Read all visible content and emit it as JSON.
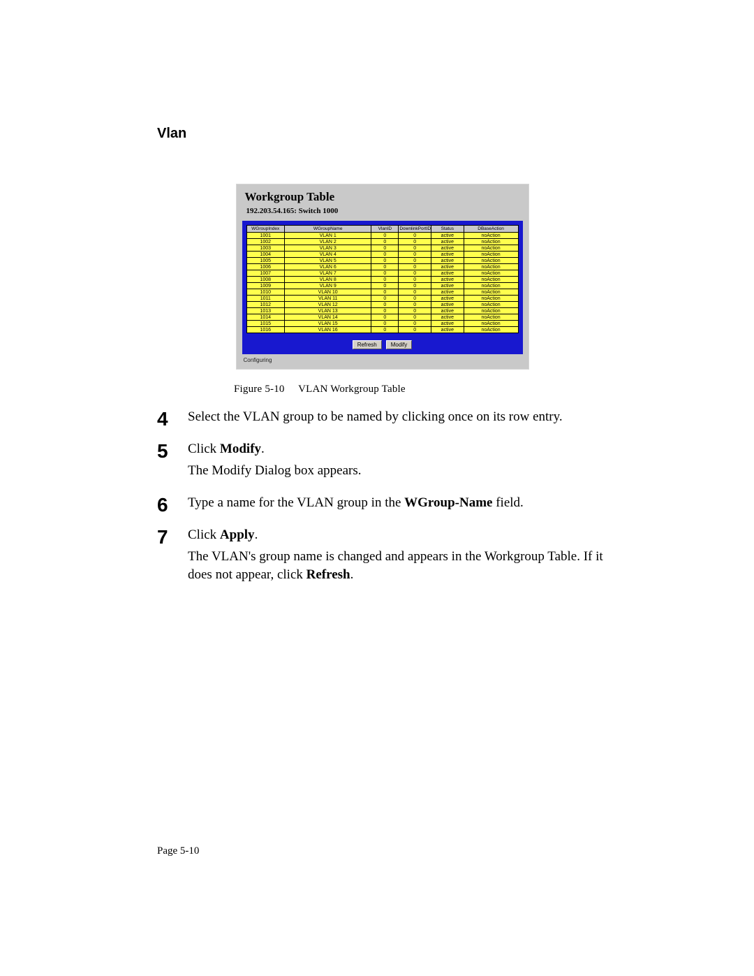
{
  "section_heading": "Vlan",
  "screenshot": {
    "title": "Workgroup Table",
    "subtitle": "192.203.54.165: Switch 1000",
    "headers": [
      "WGroupIndex",
      "WGroupName",
      "VlanID",
      "DownlinkPortID",
      "Status",
      "DBaseAction"
    ],
    "rows": [
      [
        "1001",
        "VLAN 1",
        "0",
        "0",
        "active",
        "noAction"
      ],
      [
        "1002",
        "VLAN 2",
        "0",
        "0",
        "active",
        "noAction"
      ],
      [
        "1003",
        "VLAN 3",
        "0",
        "0",
        "active",
        "noAction"
      ],
      [
        "1004",
        "VLAN 4",
        "0",
        "0",
        "active",
        "noAction"
      ],
      [
        "1005",
        "VLAN 5",
        "0",
        "0",
        "active",
        "noAction"
      ],
      [
        "1006",
        "VLAN 6",
        "0",
        "0",
        "active",
        "noAction"
      ],
      [
        "1007",
        "VLAN 7",
        "0",
        "0",
        "active",
        "noAction"
      ],
      [
        "1008",
        "VLAN 8",
        "0",
        "0",
        "active",
        "noAction"
      ],
      [
        "1009",
        "VLAN 9",
        "0",
        "0",
        "active",
        "noAction"
      ],
      [
        "1010",
        "VLAN 10",
        "0",
        "0",
        "active",
        "noAction"
      ],
      [
        "1011",
        "VLAN 11",
        "0",
        "0",
        "active",
        "noAction"
      ],
      [
        "1012",
        "VLAN 12",
        "0",
        "0",
        "active",
        "noAction"
      ],
      [
        "1013",
        "VLAN 13",
        "0",
        "0",
        "active",
        "noAction"
      ],
      [
        "1014",
        "VLAN 14",
        "0",
        "0",
        "active",
        "noAction"
      ],
      [
        "1015",
        "VLAN 15",
        "0",
        "0",
        "active",
        "noAction"
      ],
      [
        "1016",
        "VLAN 16",
        "0",
        "0",
        "active",
        "noAction"
      ]
    ],
    "buttons": {
      "refresh": "Refresh",
      "modify": "Modify"
    },
    "status": "Configuring"
  },
  "caption_label": "Figure 5-10",
  "caption_text": "VLAN Workgroup Table",
  "steps": [
    {
      "num": "4",
      "lines": [
        [
          {
            "t": "Select the VLAN group to be named by clicking once on its row entry."
          }
        ]
      ]
    },
    {
      "num": "5",
      "lines": [
        [
          {
            "t": "Click "
          },
          {
            "t": "Modify",
            "b": true
          },
          {
            "t": "."
          }
        ],
        [
          {
            "t": "The Modify Dialog box appears."
          }
        ]
      ]
    },
    {
      "num": "6",
      "lines": [
        [
          {
            "t": "Type a name for the VLAN group in the "
          },
          {
            "t": "WGroup-Name",
            "b": true
          },
          {
            "t": " field."
          }
        ]
      ]
    },
    {
      "num": "7",
      "lines": [
        [
          {
            "t": "Click "
          },
          {
            "t": "Apply",
            "b": true
          },
          {
            "t": "."
          }
        ],
        [
          {
            "t": "The VLAN's group name is changed and appears in the Workgroup Table.  If it does not appear, click "
          },
          {
            "t": "Refresh",
            "b": true
          },
          {
            "t": "."
          }
        ]
      ]
    }
  ],
  "page_number": "Page 5-10"
}
